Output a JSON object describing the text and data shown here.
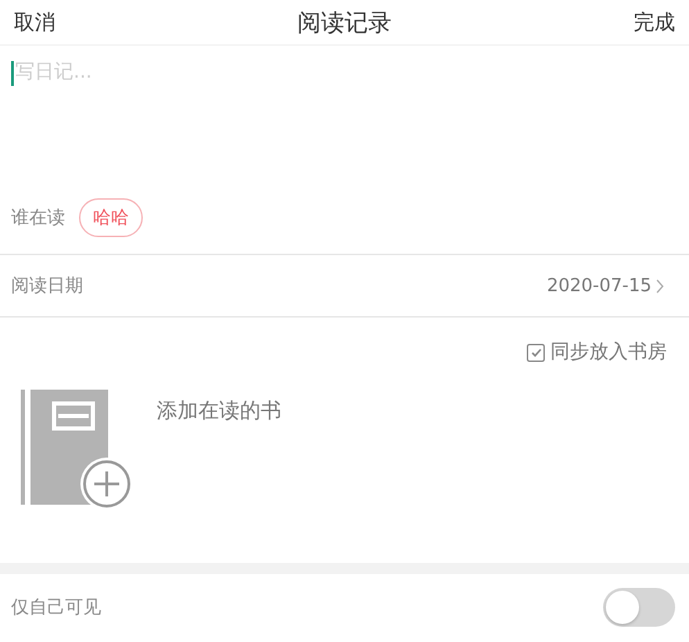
{
  "header": {
    "cancel": "取消",
    "title": "阅读记录",
    "done": "完成"
  },
  "diary": {
    "placeholder": "写日记..."
  },
  "reader": {
    "label": "谁在读",
    "name": "哈哈"
  },
  "date_row": {
    "label": "阅读日期",
    "value": "2020-07-15"
  },
  "sync": {
    "label": "同步放入书房",
    "checked": true
  },
  "add_book": {
    "label": "添加在读的书"
  },
  "privacy": {
    "label": "仅自己可见",
    "on": false
  }
}
